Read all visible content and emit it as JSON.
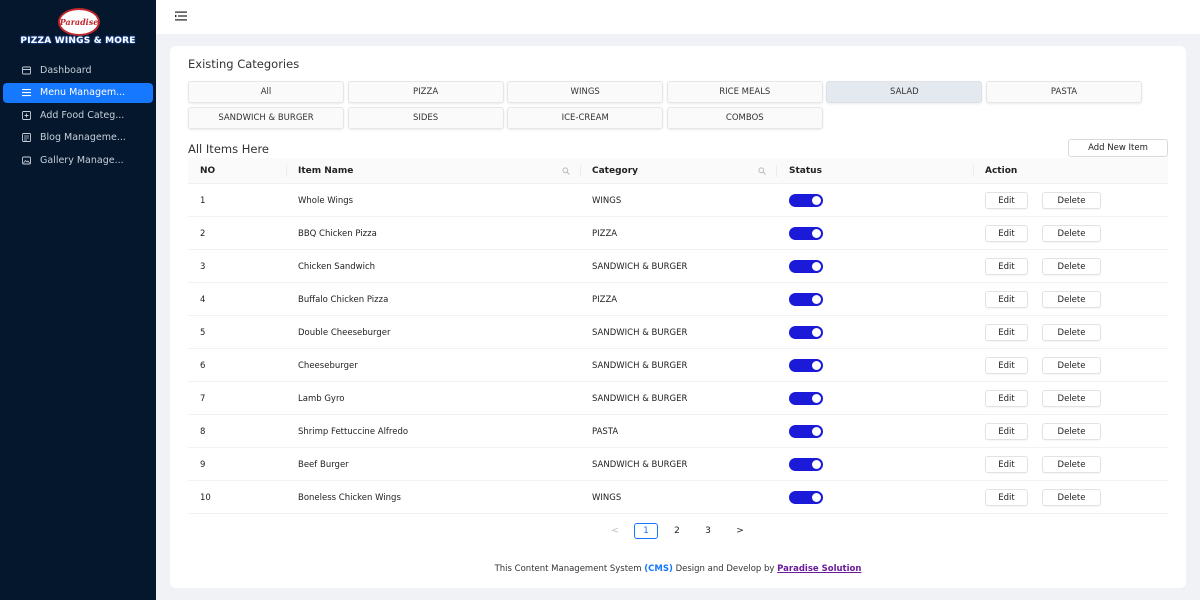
{
  "brand": {
    "logo_text": "Paradise",
    "name": "PIZZA WINGS & MORE"
  },
  "sidebar": {
    "items": [
      {
        "label": "Dashboard",
        "icon": "dashboard-icon",
        "active": false
      },
      {
        "label": "Menu Managem...",
        "icon": "menu-list-icon",
        "active": true
      },
      {
        "label": "Add Food Categ...",
        "icon": "add-food-icon",
        "active": false
      },
      {
        "label": "Blog Manageme...",
        "icon": "blog-icon",
        "active": false
      },
      {
        "label": "Gallery Manage...",
        "icon": "gallery-icon",
        "active": false
      }
    ]
  },
  "categories": {
    "title": "Existing Categories",
    "items": [
      "All",
      "PIZZA",
      "WINGS",
      "RICE MEALS",
      "SALAD",
      "PASTA",
      "SANDWICH & BURGER",
      "SIDES",
      "ICE-CREAM",
      "COMBOS"
    ],
    "selected": "SALAD"
  },
  "items_section": {
    "title": "All Items Here",
    "add_button": "Add New Item"
  },
  "table": {
    "columns": [
      "NO",
      "Item Name",
      "Category",
      "Status",
      "Action"
    ],
    "rows": [
      {
        "no": "1",
        "name": "Whole Wings",
        "category": "WINGS",
        "status": true
      },
      {
        "no": "2",
        "name": "BBQ Chicken Pizza",
        "category": "PIZZA",
        "status": true
      },
      {
        "no": "3",
        "name": "Chicken Sandwich",
        "category": "SANDWICH & BURGER",
        "status": true
      },
      {
        "no": "4",
        "name": "Buffalo Chicken Pizza",
        "category": "PIZZA",
        "status": true
      },
      {
        "no": "5",
        "name": "Double Cheeseburger",
        "category": "SANDWICH & BURGER",
        "status": true
      },
      {
        "no": "6",
        "name": "Cheeseburger",
        "category": "SANDWICH & BURGER",
        "status": true
      },
      {
        "no": "7",
        "name": "Lamb Gyro",
        "category": "SANDWICH & BURGER",
        "status": true
      },
      {
        "no": "8",
        "name": "Shrimp Fettuccine Alfredo",
        "category": "PASTA",
        "status": true
      },
      {
        "no": "9",
        "name": "Beef Burger",
        "category": "SANDWICH & BURGER",
        "status": true
      },
      {
        "no": "10",
        "name": "Boneless Chicken Wings",
        "category": "WINGS",
        "status": true
      }
    ],
    "edit_label": "Edit",
    "delete_label": "Delete"
  },
  "pagination": {
    "prev": "<",
    "pages": [
      "1",
      "2",
      "3"
    ],
    "current": "1",
    "next": ">"
  },
  "footer": {
    "prefix": "This Content Management System",
    "cms": "(CMS)",
    "middle": "Design and Develop by",
    "company": "Paradise Solution"
  },
  "colors": {
    "sidebar": "#04172d",
    "accent": "#1677ff",
    "toggle": "#1a1ad8",
    "brand_red": "#c0272d"
  }
}
